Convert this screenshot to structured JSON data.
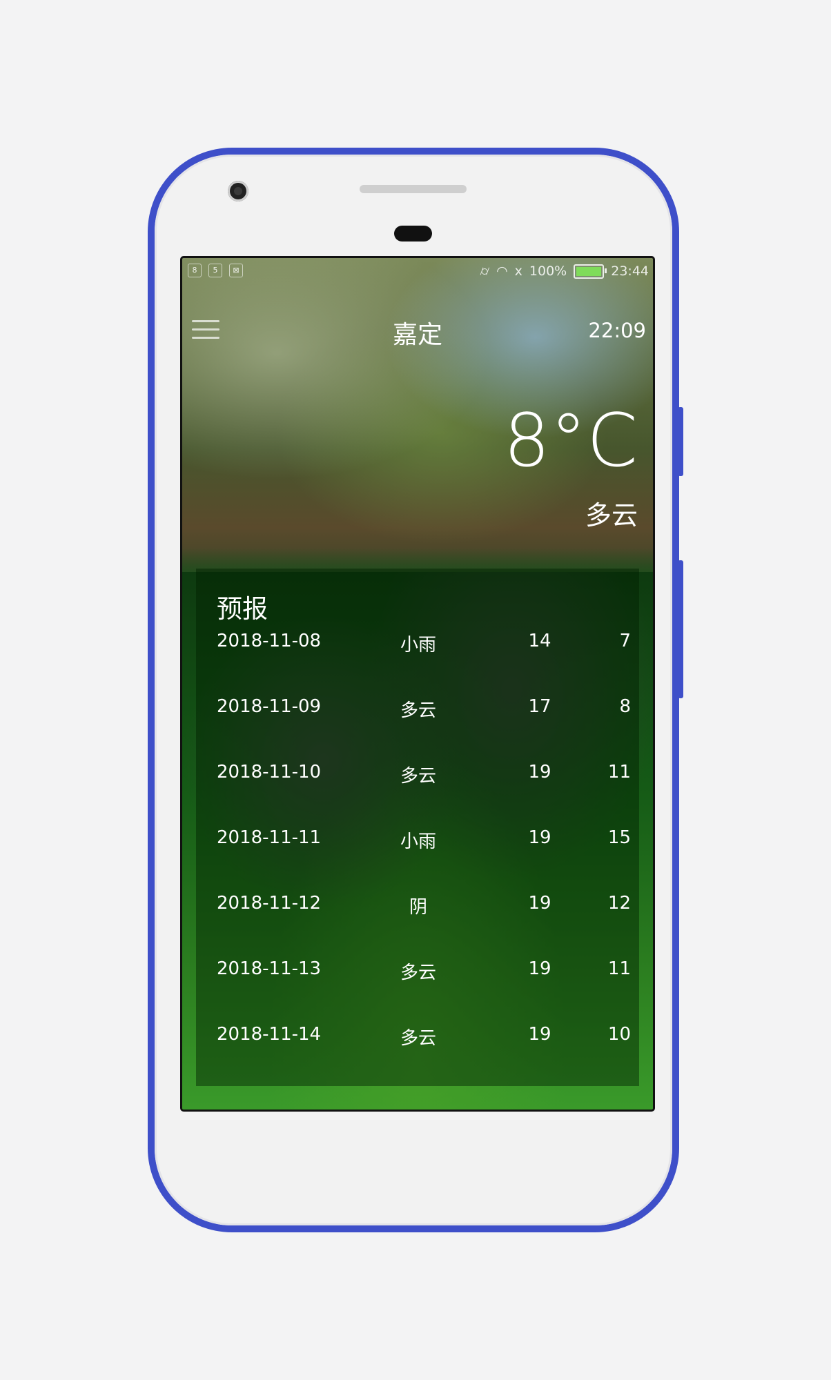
{
  "status_bar": {
    "battery_percent": "100%",
    "battery_level": 1.0,
    "time": "23:44",
    "icons": [
      "vibrate-icon",
      "wifi-icon",
      "signal-icon",
      "battery-icon"
    ]
  },
  "header": {
    "city": "嘉定",
    "update_time": "22:09",
    "menu_icon": "menu-icon"
  },
  "now": {
    "temperature": "8°C",
    "condition": "多云"
  },
  "forecast": {
    "title": "预报",
    "days": [
      {
        "date": "2018-11-08",
        "condition": "小雨",
        "max": "14",
        "min": "7"
      },
      {
        "date": "2018-11-09",
        "condition": "多云",
        "max": "17",
        "min": "8"
      },
      {
        "date": "2018-11-10",
        "condition": "多云",
        "max": "19",
        "min": "11"
      },
      {
        "date": "2018-11-11",
        "condition": "小雨",
        "max": "19",
        "min": "15"
      },
      {
        "date": "2018-11-12",
        "condition": "阴",
        "max": "19",
        "min": "12"
      },
      {
        "date": "2018-11-13",
        "condition": "多云",
        "max": "19",
        "min": "11"
      },
      {
        "date": "2018-11-14",
        "condition": "多云",
        "max": "19",
        "min": "10"
      }
    ]
  },
  "colors": {
    "phone_frame": "#3e4fc9",
    "forecast_panel": "#001e00",
    "battery_fill": "#7fdc5a"
  }
}
